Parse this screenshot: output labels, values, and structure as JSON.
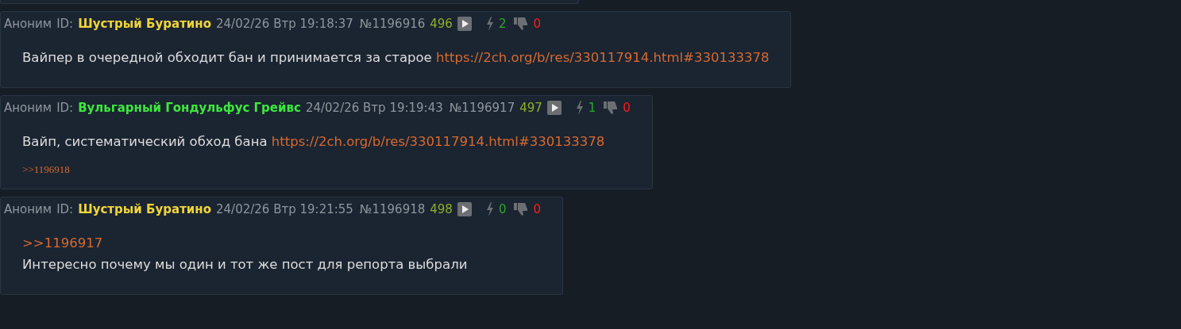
{
  "posts": [
    {
      "author": "Аноним",
      "id_label": "ID:",
      "name": "Шустрый Буратино",
      "color": "#f0d43a",
      "date": "24/02/26 Втр 19:18:37",
      "number": "№1196916",
      "ordinal": "496",
      "likes": "2",
      "dislikes": "0",
      "lines": [
        [
          {
            "kind": "text",
            "text": "Вайпер в очередной обходит бан и принимается за старое "
          },
          {
            "kind": "link",
            "text": "https://2ch.org/b/res/330117914.html#330133378"
          }
        ]
      ]
    },
    {
      "author": "Аноним",
      "id_label": "ID:",
      "name": "Вульгарный Гондульфус Грейвс",
      "color": "#3ee63e",
      "date": "24/02/26 Втр 19:19:43",
      "number": "№1196917",
      "ordinal": "497",
      "likes": "1",
      "dislikes": "0",
      "lines": [
        [
          {
            "kind": "text",
            "text": "Вайп, систематический обход бана "
          },
          {
            "kind": "link",
            "text": "https://2ch.org/b/res/330117914.html#330133378"
          }
        ]
      ],
      "backlinks": [
        ">>1196918"
      ]
    },
    {
      "author": "Аноним",
      "id_label": "ID:",
      "name": "Шустрый Буратино",
      "color": "#f0d43a",
      "date": "24/02/26 Втр 19:21:55",
      "number": "№1196918",
      "ordinal": "498",
      "likes": "0",
      "dislikes": "0",
      "lines": [
        [
          {
            "kind": "link",
            "text": ">>1196917"
          }
        ],
        [
          {
            "kind": "text",
            "text": "Интересно почему мы один и тот же пост для репорта выбрали"
          }
        ]
      ]
    }
  ]
}
